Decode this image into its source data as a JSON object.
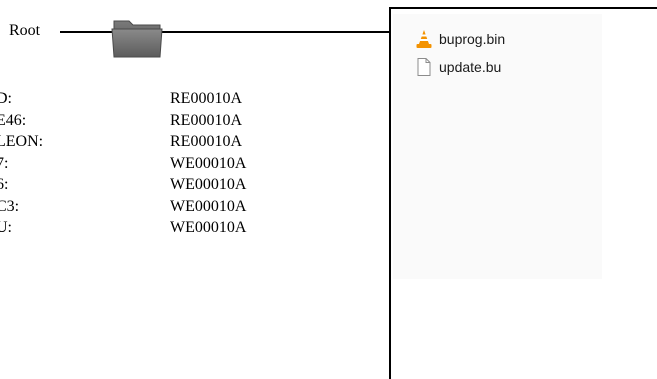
{
  "root": {
    "label": "Root"
  },
  "icons": {
    "folder": "folder-icon",
    "vlc": "vlc-cone-icon",
    "file": "blank-file-icon"
  },
  "mapping": [
    {
      "key": "D:",
      "value": "RE00010A"
    },
    {
      "key": "E46:",
      "value": "RE00010A"
    },
    {
      "key": "LEON:",
      "value": "RE00010A"
    },
    {
      "key": "7:",
      "value": "WE00010A"
    },
    {
      "key": "6:",
      "value": "WE00010A"
    },
    {
      "key": "C3:",
      "value": "WE00010A"
    },
    {
      "key": "U:",
      "value": "WE00010A"
    }
  ],
  "files": [
    {
      "name": "buprog.bin",
      "icon": "vlc-cone-icon"
    },
    {
      "name": "update.bu",
      "icon": "blank-file-icon"
    }
  ],
  "colors": {
    "folder": "#6f6f6f",
    "vlc_orange": "#f39200",
    "panel_background": "#fafafa"
  }
}
